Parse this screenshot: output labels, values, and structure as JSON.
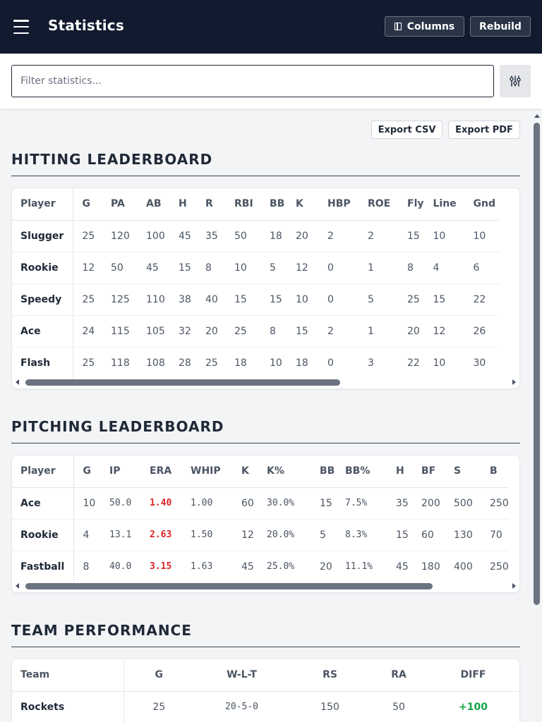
{
  "header": {
    "title": "Statistics",
    "columns_label": "Columns",
    "rebuild_label": "Rebuild",
    "menu_icon": "hamburger-icon",
    "columns_icon": "columns-icon"
  },
  "filter": {
    "placeholder": "Filter statistics...",
    "value": "",
    "settings_icon": "sliders-icon"
  },
  "exports": {
    "csv_label": "Export CSV",
    "pdf_label": "Export PDF"
  },
  "hitting": {
    "title": "HITTING LEADERBOARD",
    "columns": [
      "Player",
      "G",
      "PA",
      "AB",
      "H",
      "R",
      "RBI",
      "BB",
      "K",
      "HBP",
      "ROE",
      "Fly",
      "Line",
      "Gnd"
    ],
    "rows": [
      [
        "Slugger",
        "25",
        "120",
        "100",
        "45",
        "35",
        "50",
        "18",
        "20",
        "2",
        "2",
        "15",
        "10",
        "10"
      ],
      [
        "Rookie",
        "12",
        "50",
        "45",
        "15",
        "8",
        "10",
        "5",
        "12",
        "0",
        "1",
        "8",
        "4",
        "6"
      ],
      [
        "Speedy",
        "25",
        "125",
        "110",
        "38",
        "40",
        "15",
        "15",
        "10",
        "0",
        "5",
        "25",
        "15",
        "22"
      ],
      [
        "Ace",
        "24",
        "115",
        "105",
        "32",
        "20",
        "25",
        "8",
        "15",
        "2",
        "1",
        "20",
        "12",
        "26"
      ],
      [
        "Flash",
        "25",
        "118",
        "108",
        "28",
        "25",
        "18",
        "10",
        "18",
        "0",
        "3",
        "22",
        "10",
        "30"
      ]
    ]
  },
  "pitching": {
    "title": "PITCHING LEADERBOARD",
    "columns": [
      "Player",
      "G",
      "IP",
      "ERA",
      "WHIP",
      "K",
      "K%",
      "BB",
      "BB%",
      "H",
      "BF",
      "S",
      "B"
    ],
    "rows": [
      [
        "Ace",
        "10",
        "50.0",
        "1.40",
        "1.00",
        "60",
        "30.0%",
        "15",
        "7.5%",
        "35",
        "200",
        "500",
        "250"
      ],
      [
        "Rookie",
        "4",
        "13.1",
        "2.63",
        "1.50",
        "12",
        "20.0%",
        "5",
        "8.3%",
        "15",
        "60",
        "130",
        "70"
      ],
      [
        "Fastball",
        "8",
        "40.0",
        "3.15",
        "1.63",
        "45",
        "25.0%",
        "20",
        "11.1%",
        "45",
        "180",
        "400",
        "250"
      ]
    ],
    "era_color": "#dc2626"
  },
  "team": {
    "title": "TEAM PERFORMANCE",
    "columns": [
      "Team",
      "G",
      "W-L-T",
      "RS",
      "RA",
      "DIFF"
    ],
    "rows": [
      [
        "Rockets",
        "25",
        "20-5-0",
        "150",
        "50",
        "+100"
      ]
    ],
    "positive_color": "#16a34a"
  }
}
